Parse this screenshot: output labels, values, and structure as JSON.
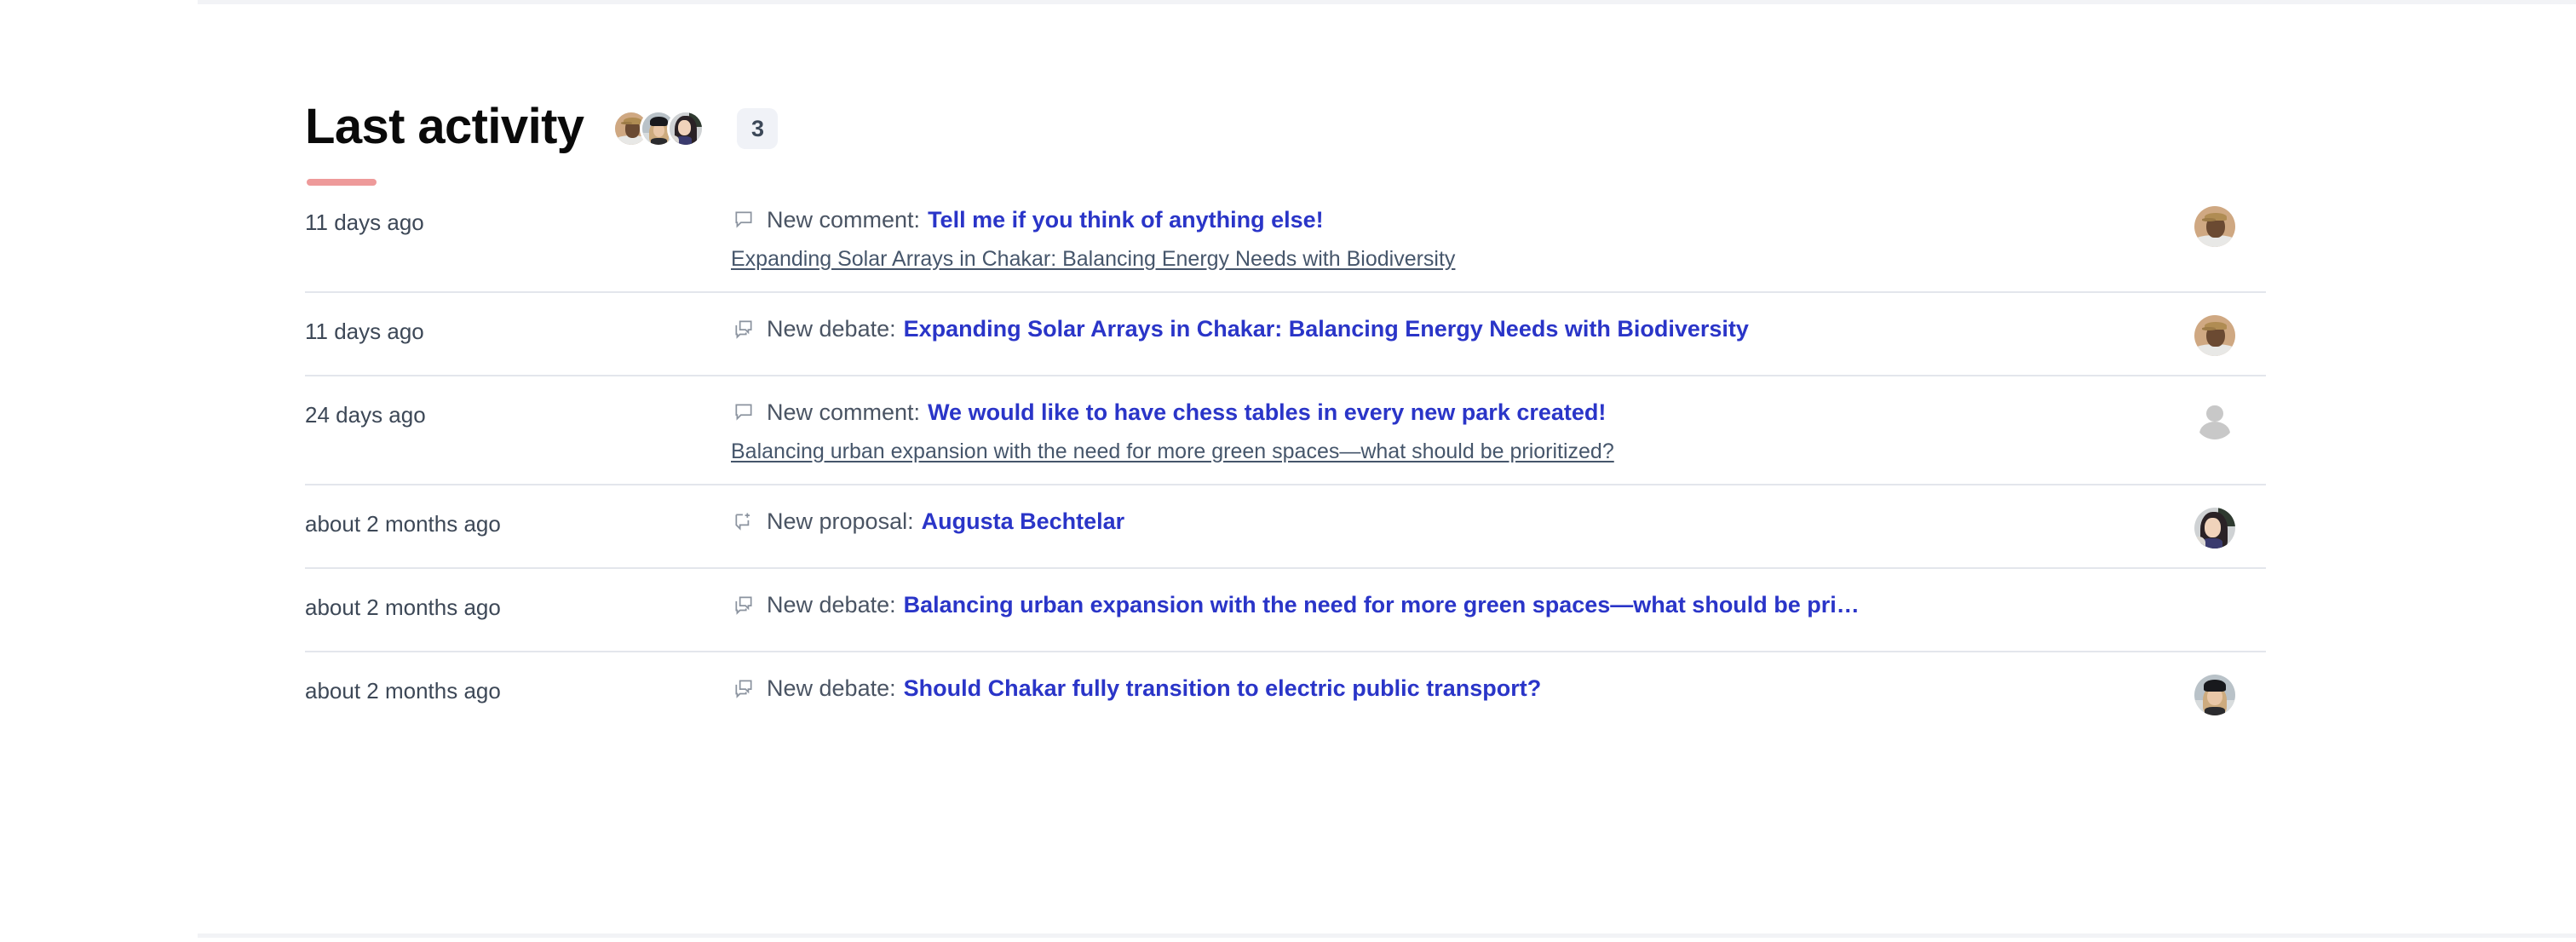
{
  "header": {
    "title": "Last activity",
    "count_badge": "3",
    "accent_color": "#ee9a9a",
    "badge_bg": "#f0f2f7",
    "avatars": [
      {
        "name": "avatar-group-member-1",
        "style": "a"
      },
      {
        "name": "avatar-group-member-2",
        "style": "b"
      },
      {
        "name": "avatar-group-member-3",
        "style": "c"
      }
    ]
  },
  "theme": {
    "link_color": "#2a35c8",
    "text_color": "#4a5463",
    "date_color": "#3d4857",
    "divider_color": "#e3e6ec",
    "sub_link_color": "#46566b"
  },
  "activities": [
    {
      "date": "11 days ago",
      "icon": "comment-bubble-icon",
      "type_label": "New comment:",
      "title": "Tell me if you think of anything else!",
      "sub_link": "Expanding Solar Arrays in Chakar: Balancing Energy Needs with Biodiversity",
      "avatar": "a"
    },
    {
      "date": "11 days ago",
      "icon": "debate-bubbles-icon",
      "type_label": "New debate:",
      "title": "Expanding Solar Arrays in Chakar: Balancing Energy Needs with Biodiversity",
      "sub_link": "",
      "avatar": "a"
    },
    {
      "date": "24 days ago",
      "icon": "comment-bubble-icon",
      "type_label": "New comment:",
      "title": "We would like to have chess tables in every new park created!",
      "sub_link": "Balancing urban expansion with the need for more green spaces—what should be prioritized?",
      "avatar": "d"
    },
    {
      "date": "about 2 months ago",
      "icon": "proposal-add-icon",
      "type_label": "New proposal:",
      "title": "Augusta Bechtelar",
      "sub_link": "",
      "avatar": "c"
    },
    {
      "date": "about 2 months ago",
      "icon": "debate-bubbles-icon",
      "type_label": "New debate:",
      "title": "Balancing urban expansion with the need for more green spaces—what should be pri…",
      "sub_link": "",
      "avatar": "none"
    },
    {
      "date": "about 2 months ago",
      "icon": "debate-bubbles-icon",
      "type_label": "New debate:",
      "title": "Should Chakar fully transition to electric public transport?",
      "sub_link": "",
      "avatar": "b"
    }
  ]
}
